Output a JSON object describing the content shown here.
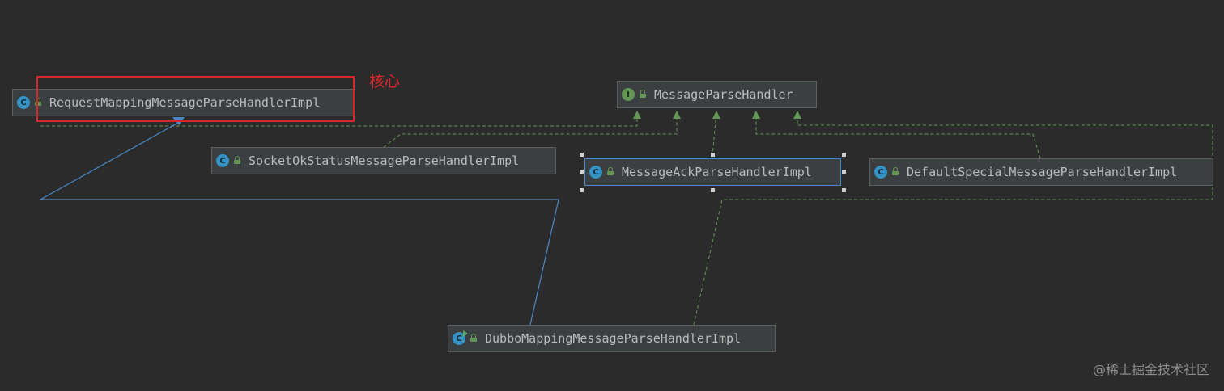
{
  "nodes": [
    {
      "id": "request_mapping",
      "label": "RequestMappingMessageParseHandlerImpl",
      "kind": "class",
      "badge": "C"
    },
    {
      "id": "message_parse_handler",
      "label": "MessageParseHandler",
      "kind": "interface",
      "badge": "I"
    },
    {
      "id": "socket_ok_status",
      "label": "SocketOkStatusMessageParseHandlerImpl",
      "kind": "class",
      "badge": "C"
    },
    {
      "id": "message_ack",
      "label": "MessageAckParseHandlerImpl",
      "kind": "class",
      "badge": "C",
      "selected": true
    },
    {
      "id": "default_special",
      "label": "DefaultSpecialMessageParseHandlerImpl",
      "kind": "class",
      "badge": "C"
    },
    {
      "id": "dubbo_mapping",
      "label": "DubboMappingMessageParseHandlerImpl",
      "kind": "class",
      "badge": "C"
    }
  ],
  "edges": [
    {
      "from": "request_mapping",
      "to": "message_parse_handler",
      "type": "implements"
    },
    {
      "from": "socket_ok_status",
      "to": "message_parse_handler",
      "type": "implements"
    },
    {
      "from": "message_ack",
      "to": "message_parse_handler",
      "type": "implements"
    },
    {
      "from": "default_special",
      "to": "message_parse_handler",
      "type": "implements"
    },
    {
      "from": "dubbo_mapping",
      "to": "message_parse_handler",
      "type": "implements"
    },
    {
      "from": "dubbo_mapping",
      "to": "request_mapping",
      "type": "extends"
    }
  ],
  "annotation": {
    "text": "核心",
    "color": "#e0262c"
  },
  "watermark": "@稀土掘金技术社区",
  "colors": {
    "background": "#2b2b2b",
    "node_fill": "#3c3f41",
    "implements_edge": "#629755",
    "extends_edge": "#4a88c7"
  }
}
